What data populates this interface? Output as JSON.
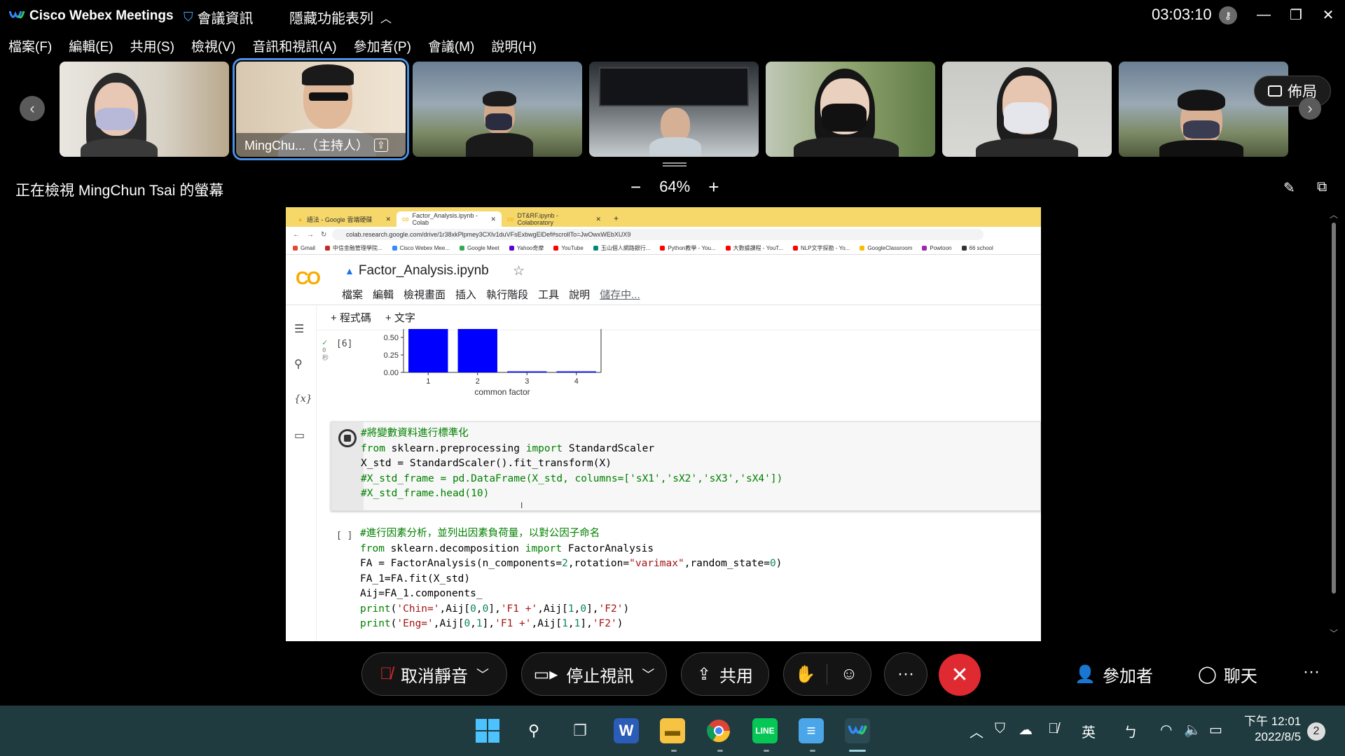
{
  "titlebar": {
    "app_name": "Cisco Webex Meetings",
    "meeting_info": "會議資訊",
    "hide_toolbar": "隱藏功能表列",
    "clock": "03:03:10"
  },
  "menu": [
    "檔案(F)",
    "編輯(E)",
    "共用(S)",
    "檢視(V)",
    "音訊和視訊(A)",
    "參加者(P)",
    "會議(M)",
    "說明(H)"
  ],
  "thumbnails": {
    "host_label": "MingChu...（主持人）",
    "layout_button": "佈局"
  },
  "share_bar": {
    "viewing_text": "正在檢視 MingChun Tsai 的螢幕",
    "zoom_level": "64%"
  },
  "browser": {
    "tabs": [
      "語法 - Google 雲端硬碟",
      "Factor_Analysis.ipynb - Colab",
      "DT&RF.ipynb - Colaboratory"
    ],
    "url": "colab.research.google.com/drive/1r38xkPlpmey3CXlv1duVFsExbwgElDef#scrollTo=JwOwxWEbXUX9",
    "bookmarks": [
      "Gmail",
      "中信金融管理學院...",
      "Cisco Webex Mee...",
      "Google Meet",
      "Yahoo奇摩",
      "YouTube",
      "玉山個人網路銀行...",
      "Python教學 - You...",
      "大數據課程 - YouT...",
      "NLP文字探勘 - Yo...",
      "GoogleClassroom",
      "Powtoon",
      "66 school"
    ]
  },
  "colab": {
    "logo": "CO",
    "notebook_title": "Factor_Analysis.ipynb",
    "menu": [
      "檔案",
      "編輯",
      "檢視畫面",
      "插入",
      "執行階段",
      "工具",
      "說明"
    ],
    "saving": "儲存中...",
    "add_code": "+ 程式碼",
    "add_text": "+ 文字",
    "cell6_label": "[6]",
    "cell6_time": "0\n秒",
    "empty_cell_label": "[ ]"
  },
  "chart_data": {
    "type": "bar",
    "categories": [
      "1",
      "2",
      "3",
      "4"
    ],
    "values": [
      0.98,
      0.97,
      0.01,
      0.01
    ],
    "xlabel": "common factor",
    "yticks": [
      "0.50",
      "0.25",
      "0.00"
    ],
    "ylim": [
      0,
      0.75
    ],
    "bar_color": "#0000ff"
  },
  "code_cell_1": [
    "#將變數資料進行標準化",
    "from sklearn.preprocessing import StandardScaler",
    "X_std = StandardScaler().fit_transform(X)",
    "#X_std_frame = pd.DataFrame(X_std, columns=['sX1','sX2','sX3','sX4'])",
    "#X_std_frame.head(10)"
  ],
  "code_cell_2": [
    "#進行因素分析，並列出因素負荷量，以對公因子命名",
    "from sklearn.decomposition import FactorAnalysis",
    "FA = FactorAnalysis(n_components=2,rotation=\"varimax\",random_state=0)",
    "FA_1=FA.fit(X_std)",
    "Aij=FA_1.components_",
    "print('Chin=',Aij[0,0],'F1 +',Aij[1,0],'F2')",
    "print('Eng=',Aij[0,1],'F1 +',Aij[1,1],'F2')"
  ],
  "controls": {
    "unmute": "取消靜音",
    "stop_video": "停止視訊",
    "share": "共用",
    "participants": "參加者",
    "chat": "聊天"
  },
  "taskbar": {
    "ime": "英",
    "ime2": "ㄅ",
    "time": "下午 12:01",
    "date": "2022/8/5",
    "notifications": "2"
  }
}
